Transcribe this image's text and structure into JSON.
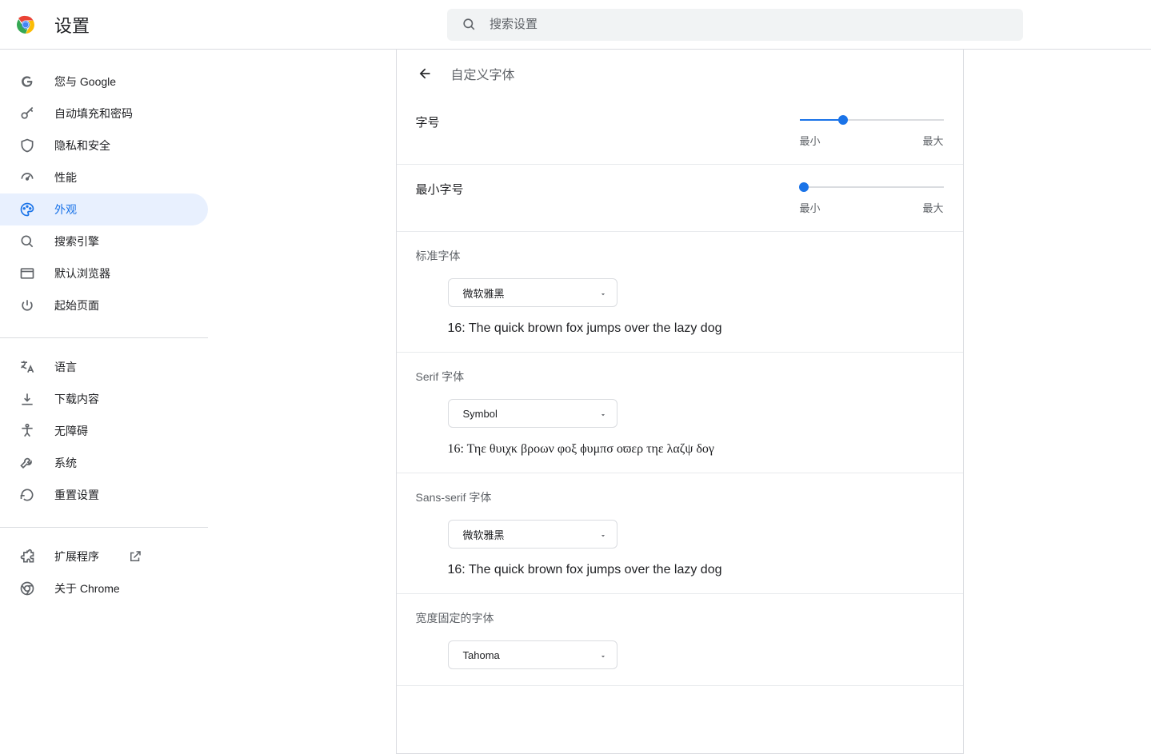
{
  "header": {
    "title": "设置",
    "search_placeholder": "搜索设置"
  },
  "sidebar": {
    "groups": [
      {
        "items": [
          {
            "icon": "g-icon",
            "label": "您与 Google"
          },
          {
            "icon": "key-icon",
            "label": "自动填充和密码"
          },
          {
            "icon": "shield-icon",
            "label": "隐私和安全"
          },
          {
            "icon": "speedometer-icon",
            "label": "性能"
          },
          {
            "icon": "palette-icon",
            "label": "外观",
            "active": true
          },
          {
            "icon": "search-icon",
            "label": "搜索引擎"
          },
          {
            "icon": "window-icon",
            "label": "默认浏览器"
          },
          {
            "icon": "power-icon",
            "label": "起始页面"
          }
        ]
      },
      {
        "items": [
          {
            "icon": "translate-icon",
            "label": "语言"
          },
          {
            "icon": "download-icon",
            "label": "下载内容"
          },
          {
            "icon": "accessibility-icon",
            "label": "无障碍"
          },
          {
            "icon": "wrench-icon",
            "label": "系统"
          },
          {
            "icon": "reset-icon",
            "label": "重置设置"
          }
        ]
      },
      {
        "items": [
          {
            "icon": "puzzle-icon",
            "label": "扩展程序",
            "external": true
          },
          {
            "icon": "chrome-icon",
            "label": "关于 Chrome"
          }
        ]
      }
    ]
  },
  "page": {
    "title": "自定义字体",
    "font_size": {
      "label": "字号",
      "min_label": "最小",
      "max_label": "最大",
      "value_pct": 30
    },
    "min_font_size": {
      "label": "最小字号",
      "min_label": "最小",
      "max_label": "最大",
      "value_pct": 0
    },
    "fonts": [
      {
        "section": "标准字体",
        "selected": "微软雅黑",
        "sample": "16: The quick brown fox jumps over the lazy dog",
        "class": "sans"
      },
      {
        "section": "Serif 字体",
        "selected": "Symbol",
        "sample": "16: Τηε θυιχκ βροων φοξ ϕυμπσ οϖερ τηε λαζψ δογ",
        "class": "serif"
      },
      {
        "section": "Sans-serif 字体",
        "selected": "微软雅黑",
        "sample": "16: The quick brown fox jumps over the lazy dog",
        "class": "sans"
      },
      {
        "section": "宽度固定的字体",
        "selected": "Tahoma",
        "sample": "",
        "class": ""
      }
    ]
  }
}
